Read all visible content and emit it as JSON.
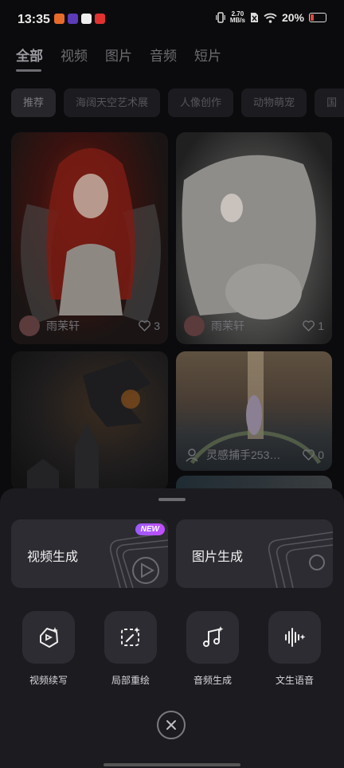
{
  "status": {
    "time": "13:35",
    "net_speed_value": "2.70",
    "net_speed_unit": "MB/s",
    "battery": "20%"
  },
  "tabs": [
    {
      "label": "全部",
      "active": true
    },
    {
      "label": "视频"
    },
    {
      "label": "图片"
    },
    {
      "label": "音频"
    },
    {
      "label": "短片"
    }
  ],
  "chips": [
    "推荐",
    "海阔天空艺术展",
    "人像创作",
    "动物萌宠",
    "国"
  ],
  "feed": {
    "cards": [
      {
        "author": "雨茉轩",
        "likes": "3"
      },
      {
        "author": "雨茉轩",
        "likes": "1"
      },
      {
        "author": "",
        "likes": ""
      },
      {
        "author": "灵感捕手253…",
        "likes": "0"
      }
    ]
  },
  "sheet": {
    "video_gen": "视频生成",
    "new_badge": "NEW",
    "image_gen": "图片生成",
    "tools": [
      "视频续写",
      "局部重绘",
      "音频生成",
      "文生语音"
    ]
  },
  "colors": {
    "accent": "#b44dff",
    "sheet_bg": "#1c1c20",
    "card_bg": "#2c2c32"
  }
}
